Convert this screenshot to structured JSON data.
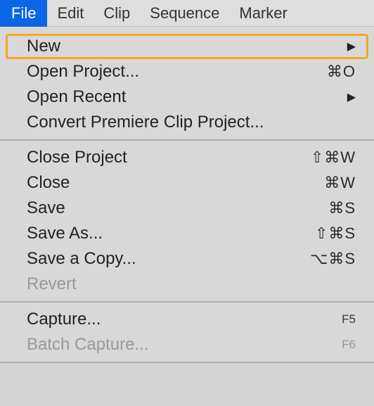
{
  "menubar": {
    "items": [
      {
        "label": "File",
        "selected": true
      },
      {
        "label": "Edit"
      },
      {
        "label": "Clip"
      },
      {
        "label": "Sequence"
      },
      {
        "label": "Marker"
      }
    ]
  },
  "menu": {
    "group1": [
      {
        "label": "New",
        "submenu": true,
        "highlighted": true
      },
      {
        "label": "Open Project...",
        "shortcut": "⌘O"
      },
      {
        "label": "Open Recent",
        "submenu": true
      },
      {
        "label": "Convert Premiere Clip Project..."
      }
    ],
    "group2": [
      {
        "label": "Close Project",
        "shortcut": "⇧⌘W"
      },
      {
        "label": "Close",
        "shortcut": "⌘W"
      },
      {
        "label": "Save",
        "shortcut": "⌘S"
      },
      {
        "label": "Save As...",
        "shortcut": "⇧⌘S"
      },
      {
        "label": "Save a Copy...",
        "shortcut": "⌥⌘S"
      },
      {
        "label": "Revert",
        "disabled": true
      }
    ],
    "group3": [
      {
        "label": "Capture...",
        "fkey": "F5"
      },
      {
        "label": "Batch Capture...",
        "fkey": "F6",
        "disabled": true
      }
    ]
  },
  "glyphs": {
    "arrow": "▶"
  }
}
